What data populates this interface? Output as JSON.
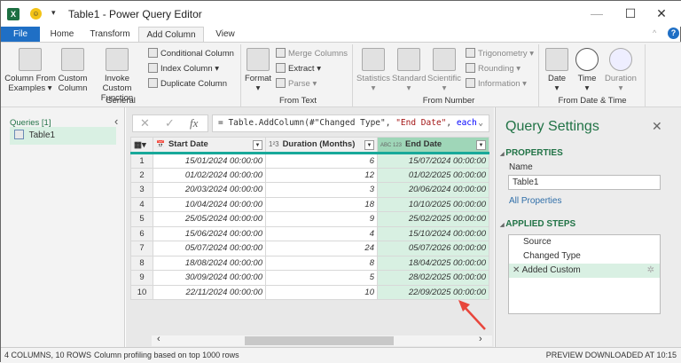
{
  "window": {
    "title": "Table1 - Power Query Editor",
    "app_icon": "excel-icon",
    "minimize": "—",
    "maximize": "☐",
    "close": "✕"
  },
  "tabs": [
    {
      "label": "File"
    },
    {
      "label": "Home"
    },
    {
      "label": "Transform"
    },
    {
      "label": "Add Column",
      "active": true
    },
    {
      "label": "View"
    }
  ],
  "ribbon": {
    "general": {
      "label": "General",
      "column_from_examples": "Column From Examples",
      "custom_column": "Custom Column",
      "invoke_custom_function": "Invoke Custom Function",
      "conditional_column": "Conditional Column",
      "index_column": "Index Column",
      "duplicate_column": "Duplicate Column"
    },
    "from_text": {
      "label": "From Text",
      "format": "Format",
      "merge_columns": "Merge Columns",
      "extract": "Extract",
      "parse": "Parse"
    },
    "from_number": {
      "label": "From Number",
      "statistics": "Statistics",
      "standard": "Standard",
      "scientific": "Scientific",
      "trigonometry": "Trigonometry",
      "rounding": "Rounding",
      "information": "Information"
    },
    "from_date_time": {
      "label": "From Date & Time",
      "date": "Date",
      "time": "Time",
      "duration": "Duration"
    }
  },
  "queries": {
    "header": "Queries [1]",
    "items": [
      {
        "label": "Table1"
      }
    ]
  },
  "formula": {
    "prefix": "= Table.AddColumn(#\"Changed Type\", ",
    "string": "\"End Date\"",
    ", ": ", ",
    "keyword": "each",
    "cancel": "✕",
    "confirm": "✓",
    "fx": "fx"
  },
  "grid": {
    "columns": [
      {
        "type_icon": "date-time",
        "label": "Start Date"
      },
      {
        "type_icon": "1²3",
        "label": "Duration (Months)"
      },
      {
        "type_icon": "ABC 123",
        "label": "End Date",
        "selected": true
      }
    ],
    "rows": [
      [
        "1",
        "15/01/2024 00:00:00",
        "6",
        "15/07/2024 00:00:00"
      ],
      [
        "2",
        "01/02/2024 00:00:00",
        "12",
        "01/02/2025 00:00:00"
      ],
      [
        "3",
        "20/03/2024 00:00:00",
        "3",
        "20/06/2024 00:00:00"
      ],
      [
        "4",
        "10/04/2024 00:00:00",
        "18",
        "10/10/2025 00:00:00"
      ],
      [
        "5",
        "25/05/2024 00:00:00",
        "9",
        "25/02/2025 00:00:00"
      ],
      [
        "6",
        "15/06/2024 00:00:00",
        "4",
        "15/10/2024 00:00:00"
      ],
      [
        "7",
        "05/07/2024 00:00:00",
        "24",
        "05/07/2026 00:00:00"
      ],
      [
        "8",
        "18/08/2024 00:00:00",
        "8",
        "18/04/2025 00:00:00"
      ],
      [
        "9",
        "30/09/2024 00:00:00",
        "5",
        "28/02/2025 00:00:00"
      ],
      [
        "10",
        "22/11/2024 00:00:00",
        "10",
        "22/09/2025 00:00:00"
      ]
    ]
  },
  "settings": {
    "title": "Query Settings",
    "properties": "PROPERTIES",
    "name_label": "Name",
    "name_value": "Table1",
    "all_properties": "All Properties",
    "applied_steps": "APPLIED STEPS",
    "steps": [
      {
        "label": "Source"
      },
      {
        "label": "Changed Type"
      },
      {
        "label": "Added Custom",
        "selected": true
      }
    ]
  },
  "status": {
    "left": "4 COLUMNS, 10 ROWS",
    "profiling": "Column profiling based on top 1000 rows",
    "right": "PREVIEW DOWNLOADED AT 10:15"
  },
  "colors": {
    "accent": "#217346",
    "file_tab": "#1f6fc5",
    "selected_column": "#9fd6b8",
    "annotation_arrow": "#e8463c"
  }
}
